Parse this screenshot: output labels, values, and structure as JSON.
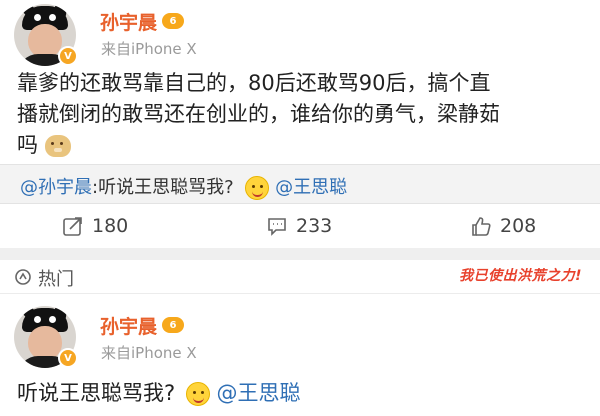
{
  "post1": {
    "username": "孙宇晨",
    "vip_badge": "6",
    "verified_badge": "V",
    "source": "来自iPhone X",
    "text_line1": "靠爹的还敢骂靠自己的，80后还敢骂90后，搞个直",
    "text_line2": "播就倒闭的敢骂还在创业的，谁给你的勇气，梁静茹",
    "text_line3": "吗",
    "emoji": "doge-emoji"
  },
  "repost": {
    "user": "@孙宇晨",
    "text": ":听说王思聪骂我?",
    "emoji": "smile-emoji",
    "mention": "@王思聪"
  },
  "actions": {
    "repost_count": "180",
    "comment_count": "233",
    "like_count": "208",
    "repost_icon": "share-icon",
    "comment_icon": "comment-icon",
    "like_icon": "thumbs-up-icon"
  },
  "hot": {
    "label": "热门",
    "sticker": "我已使出洪荒之力!"
  },
  "post2": {
    "username": "孙宇晨",
    "vip_badge": "6",
    "verified_badge": "V",
    "source": "来自iPhone X",
    "text": "听说王思聪骂我?",
    "emoji": "smile-emoji",
    "mention": "@王思聪"
  },
  "colors": {
    "username": "#e8612c",
    "mention": "#2f6fb5",
    "vip": "#f7a81b"
  }
}
